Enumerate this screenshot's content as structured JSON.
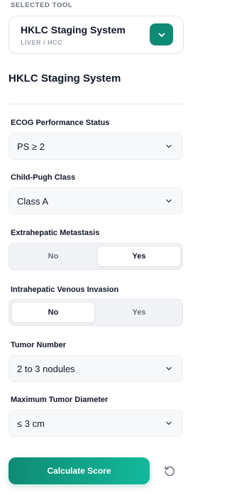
{
  "selected_tool": {
    "label": "SELECTED TOOL",
    "name": "HKLC Staging System",
    "category": "LIVER / HCC",
    "toggle_icon": "chevron-down-icon",
    "accent_color": "#0f8a74"
  },
  "form": {
    "title": "HKLC Staging System",
    "fields": [
      {
        "label": "ECOG Performance Status",
        "type": "select",
        "value": "PS ≥ 2"
      },
      {
        "label": "Child-Pugh Class",
        "type": "select",
        "value": "Class A"
      },
      {
        "label": "Extrahepatic Metastasis",
        "type": "toggle",
        "options": [
          "No",
          "Yes"
        ],
        "value": "Yes"
      },
      {
        "label": "Intrahepatic Venous Invasion",
        "type": "toggle",
        "options": [
          "No",
          "Yes"
        ],
        "value": "No"
      },
      {
        "label": "Tumor Number",
        "type": "select",
        "value": "2 to 3 nodules"
      },
      {
        "label": "Maximum Tumor Diameter",
        "type": "select",
        "value": "≤ 3 cm"
      }
    ]
  },
  "actions": {
    "calculate_label": "Calculate Score",
    "reset_icon": "reset-icon"
  }
}
